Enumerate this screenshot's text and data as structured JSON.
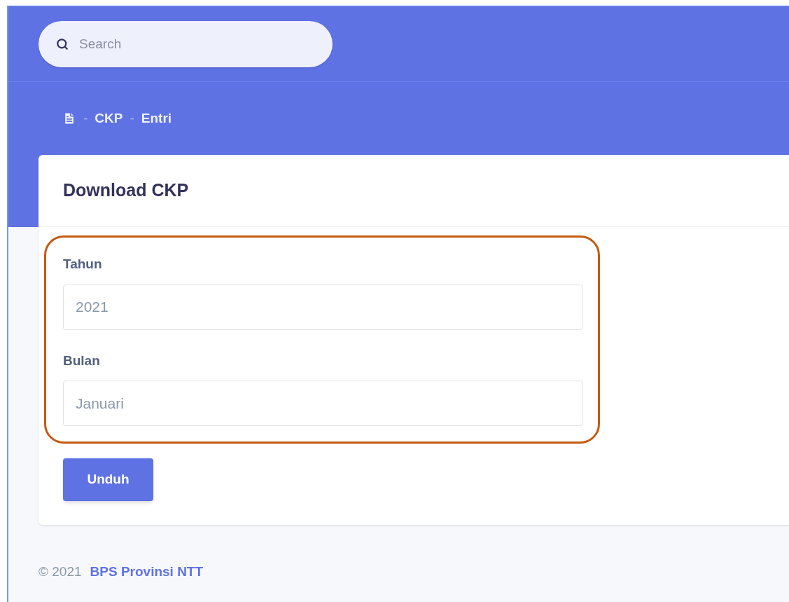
{
  "search": {
    "placeholder": "Search"
  },
  "breadcrumb": [
    {
      "separator": "-",
      "label": "CKP"
    },
    {
      "separator": "-",
      "label": "Entri"
    }
  ],
  "card": {
    "title": "Download CKP",
    "fields": [
      {
        "label": "Tahun",
        "placeholder": "2021"
      },
      {
        "label": "Bulan",
        "placeholder": "Januari"
      }
    ],
    "button": "Unduh"
  },
  "footer": {
    "copyright": "© 2021",
    "link": "BPS Provinsi NTT"
  }
}
